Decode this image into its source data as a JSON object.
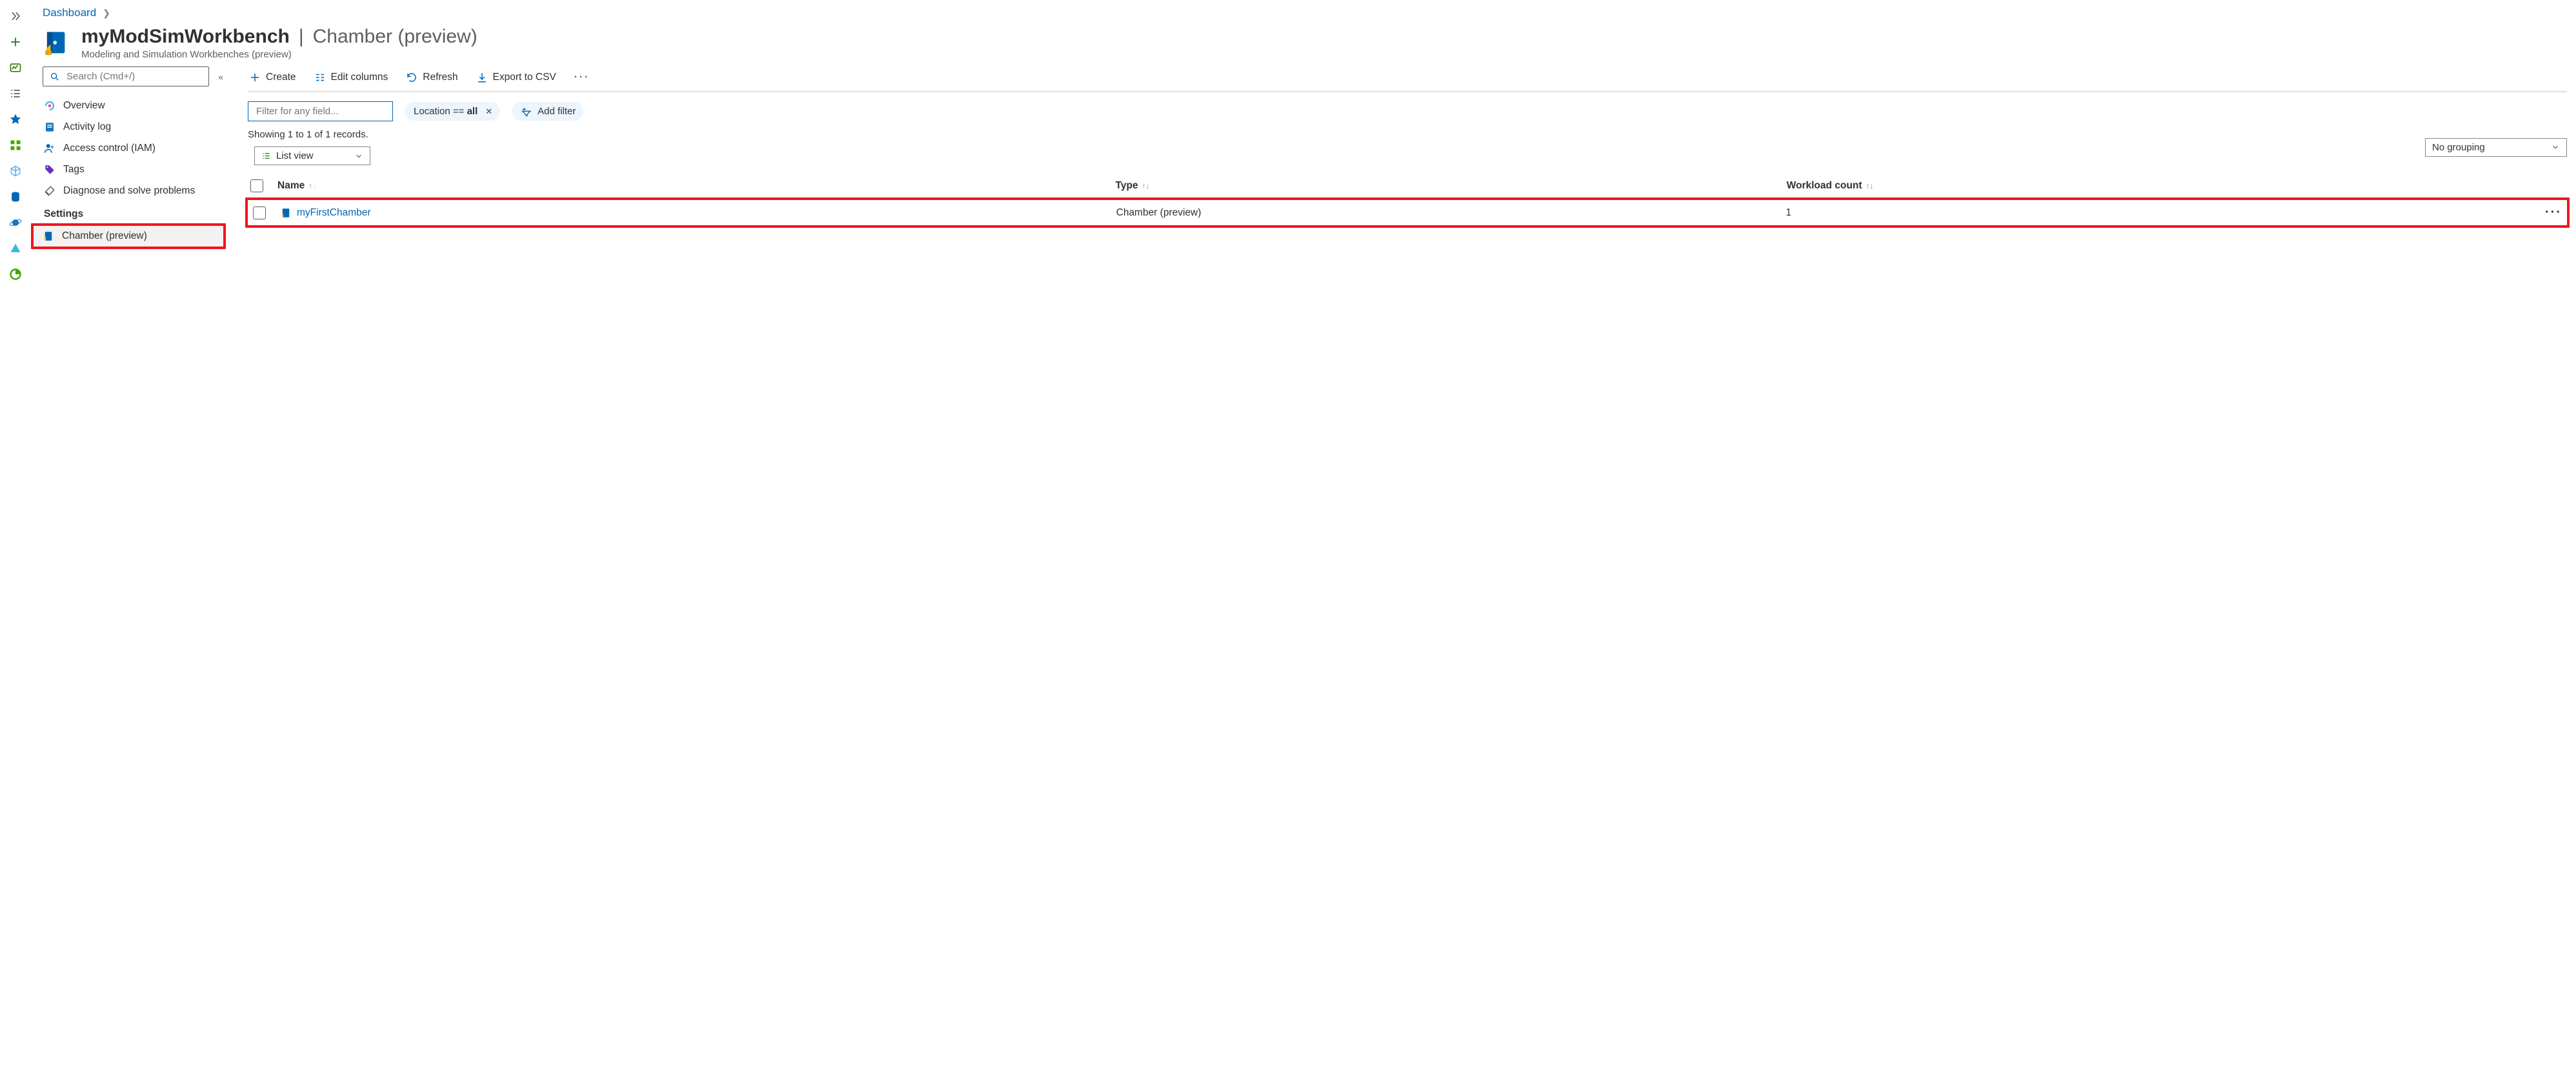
{
  "rail": {
    "items": [
      {
        "name": "expand",
        "title": "Expand"
      },
      {
        "name": "create",
        "title": "Create a resource"
      },
      {
        "name": "dashboard",
        "title": "Dashboard"
      },
      {
        "name": "all-services",
        "title": "All services"
      },
      {
        "name": "favorites",
        "title": "Favorites"
      },
      {
        "name": "resource-groups",
        "title": "Resource groups"
      },
      {
        "name": "kubernetes",
        "title": "Kubernetes"
      },
      {
        "name": "sql",
        "title": "SQL"
      },
      {
        "name": "cosmos",
        "title": "Cosmos DB"
      },
      {
        "name": "pyramid",
        "title": "Monitor"
      },
      {
        "name": "cost",
        "title": "Cost"
      }
    ]
  },
  "breadcrumb": {
    "root": "Dashboard"
  },
  "header": {
    "title_main": "myModSimWorkbench",
    "title_sep": "|",
    "title_sub": "Chamber (preview)",
    "subtitle": "Modeling and Simulation Workbenches (preview)"
  },
  "resmenu": {
    "search_placeholder": "Search (Cmd+/)",
    "items": [
      {
        "icon": "overview",
        "label": "Overview"
      },
      {
        "icon": "activity",
        "label": "Activity log"
      },
      {
        "icon": "iam",
        "label": "Access control (IAM)"
      },
      {
        "icon": "tags",
        "label": "Tags"
      },
      {
        "icon": "diagnose",
        "label": "Diagnose and solve problems"
      }
    ],
    "settings_heading": "Settings",
    "settings_items": [
      {
        "icon": "chamber",
        "label": "Chamber (preview)",
        "selected": true,
        "highlight": true
      }
    ]
  },
  "toolbar": {
    "create": "Create",
    "edit_columns": "Edit columns",
    "refresh": "Refresh",
    "export_csv": "Export to CSV"
  },
  "filters": {
    "field_placeholder": "Filter for any field...",
    "location_label_prefix": "Location == ",
    "location_value": "all",
    "add_filter": "Add filter"
  },
  "resultbar": {
    "text": "Showing 1 to 1 of 1 records.",
    "grouping": "No grouping",
    "view": "List view"
  },
  "table": {
    "cols": {
      "name": "Name",
      "type": "Type",
      "workload": "Workload count"
    },
    "rows": [
      {
        "name": "myFirstChamber",
        "type": "Chamber (preview)",
        "workload": "1"
      }
    ]
  }
}
